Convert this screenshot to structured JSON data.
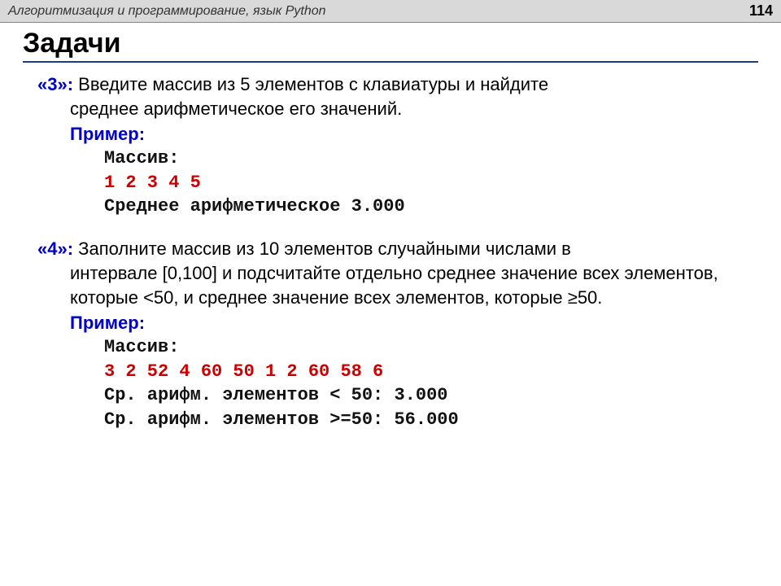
{
  "header": {
    "subject": "Алгоритмизация и программирование, язык Python",
    "page_number": "114"
  },
  "title": "Задачи",
  "tasks": {
    "t3": {
      "grade": "«3»:",
      "desc_first": "Введите массив из 5 элементов с клавиатуры и найдите",
      "desc_rest": "среднее арифметическое его значений.",
      "example_label": "Пример:",
      "mono1": "Массив:",
      "mono2": "1 2 3 4 5",
      "mono3": "Среднее арифметическое 3.000"
    },
    "t4": {
      "grade": "«4»:",
      "desc_first": "Заполните массив из 10 элементов случайными числами в",
      "desc_rest": "интервале [0,100] и подсчитайте отдельно среднее значение всех элементов, которые <50, и среднее значение всех элементов, которые ≥50.",
      "example_label": "Пример:",
      "mono1": "Массив:",
      "mono2": "3 2 52 4 60 50 1 2 60 58 6",
      "mono3": "Ср. арифм. элементов < 50: 3.000",
      "mono4": "Ср. арифм. элементов >=50: 56.000"
    }
  }
}
